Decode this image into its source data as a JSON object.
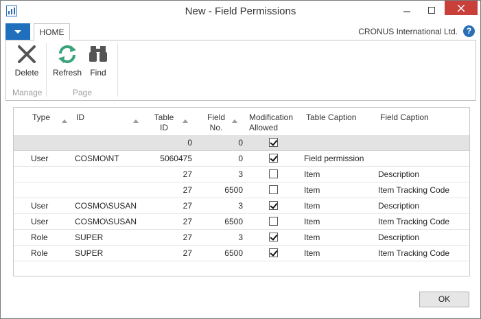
{
  "window": {
    "title": "New - Field Permissions"
  },
  "ribbon": {
    "tab": "HOME",
    "company": "CRONUS International Ltd.",
    "help": "?",
    "buttons": [
      {
        "label": "Delete",
        "icon": "delete-x-icon"
      },
      {
        "label": "Refresh",
        "icon": "refresh-icon"
      },
      {
        "label": "Find",
        "icon": "binoculars-icon"
      }
    ],
    "groups": [
      "Manage",
      "Page"
    ]
  },
  "grid": {
    "headers": {
      "type": "Type",
      "id": "ID",
      "table_id_1": "Table",
      "table_id_2": "ID",
      "field_no_1": "Field",
      "field_no_2": "No.",
      "mod_1": "Modification",
      "mod_2": "Allowed",
      "table_caption": "Table Caption",
      "field_caption": "Field Caption"
    },
    "rows": [
      {
        "type": "",
        "id": "",
        "table_id": "0",
        "field_no": "0",
        "allowed": true,
        "table_caption": "",
        "field_caption": "",
        "selected": true
      },
      {
        "type": "User",
        "id": "COSMO\\NT",
        "table_id": "5060475",
        "field_no": "0",
        "allowed": true,
        "table_caption": "Field permission",
        "field_caption": ""
      },
      {
        "type": "",
        "id": "",
        "table_id": "27",
        "field_no": "3",
        "allowed": false,
        "table_caption": "Item",
        "field_caption": "Description"
      },
      {
        "type": "",
        "id": "",
        "table_id": "27",
        "field_no": "6500",
        "allowed": false,
        "table_caption": "Item",
        "field_caption": "Item Tracking Code"
      },
      {
        "type": "User",
        "id": "COSMO\\SUSAN",
        "table_id": "27",
        "field_no": "3",
        "allowed": true,
        "table_caption": "Item",
        "field_caption": "Description"
      },
      {
        "type": "User",
        "id": "COSMO\\SUSAN",
        "table_id": "27",
        "field_no": "6500",
        "allowed": false,
        "table_caption": "Item",
        "field_caption": "Item Tracking Code"
      },
      {
        "type": "Role",
        "id": "SUPER",
        "table_id": "27",
        "field_no": "3",
        "allowed": true,
        "table_caption": "Item",
        "field_caption": "Description"
      },
      {
        "type": "Role",
        "id": "SUPER",
        "table_id": "27",
        "field_no": "6500",
        "allowed": true,
        "table_caption": "Item",
        "field_caption": "Item Tracking Code"
      }
    ]
  },
  "footer": {
    "ok_label": "OK"
  },
  "colors": {
    "accent": "#1f6fbd",
    "close": "#c9403a",
    "selected_row": "#e3e3e3"
  }
}
